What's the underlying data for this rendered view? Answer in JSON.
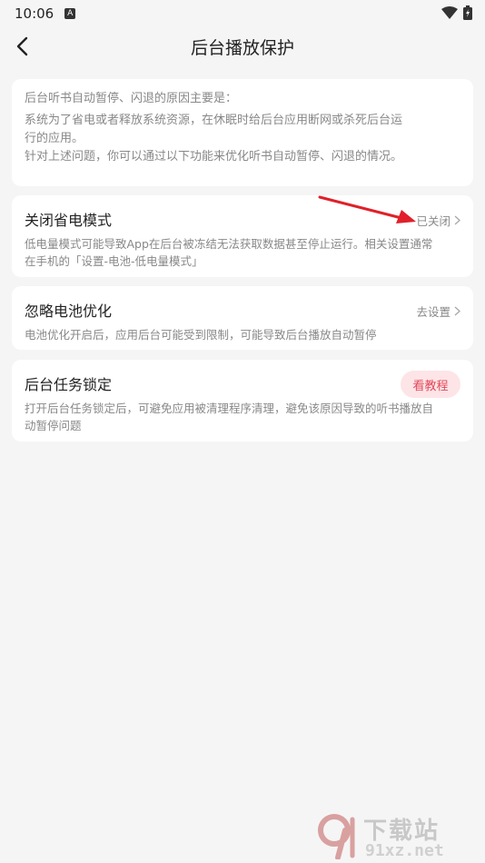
{
  "status_bar": {
    "time": "10:06",
    "notification_letter": "A"
  },
  "nav": {
    "title": "后台播放保护"
  },
  "intro": {
    "lines": [
      "后台听书自动暂停、闪退的原因主要是：",
      "系统为了省电或者释放系统资源，在休眠时给后台应用断网或杀死后台运",
      "行的应用。",
      "针对上述问题，你可以通过以下功能来优化听书自动暂停、闪退的情况。"
    ]
  },
  "settings": [
    {
      "title": "关闭省电模式",
      "action": "已关闭",
      "desc_lines": [
        "低电量模式可能导致App在后台被冻结无法获取数据甚至停止运行。相关设置通常",
        "在手机的「设置-电池-低电量模式」"
      ]
    },
    {
      "title": "忽略电池优化",
      "action": "去设置",
      "desc_lines": [
        "电池优化开启后，应用后台可能受到限制，可能导致后台播放自动暂停"
      ]
    },
    {
      "title": "后台任务锁定",
      "action": "看教程",
      "desc_lines": [
        "打开后台任务锁定后，可避免应用被清理程序清理，避免该原因导致的听书播放自",
        "动暂停问题"
      ]
    }
  ],
  "watermark": {
    "top": "下载站",
    "bottom": "91xz.net"
  },
  "colors": {
    "accent": "#e14a5a",
    "accent_bg": "#fde4e7",
    "arrow": "#e0202a",
    "background": "#f5f5f5"
  }
}
